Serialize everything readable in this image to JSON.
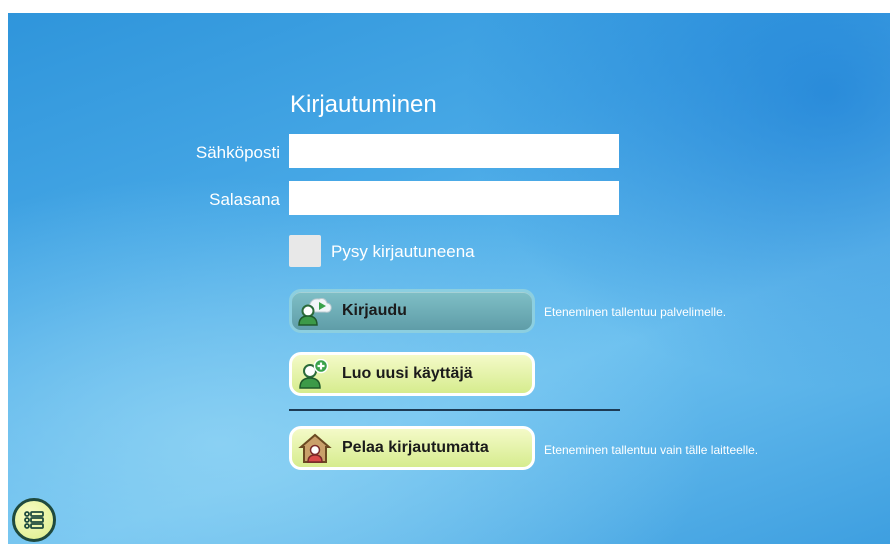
{
  "login": {
    "title": "Kirjautuminen",
    "email_label": "Sähköposti",
    "email_value": "",
    "password_label": "Salasana",
    "password_value": "",
    "remember_label": "Pysy kirjautuneena",
    "remember_checked": false
  },
  "buttons": {
    "login_label": "Kirjaudu",
    "login_note": "Eteneminen tallentuu palvelimelle.",
    "create_label": "Luo uusi käyttäjä",
    "guest_label": "Pelaa kirjautumatta",
    "guest_note": "Eteneminen tallentuu vain tälle laitteelle."
  },
  "icons": {
    "login": "user-cloud-icon",
    "create": "add-user-icon",
    "guest": "house-user-icon",
    "menu": "list-menu-icon"
  },
  "colors": {
    "background": "#47a8e6",
    "login_button": "#6faeb6",
    "action_button": "#e3f3a6",
    "divider": "#1d3b55"
  }
}
